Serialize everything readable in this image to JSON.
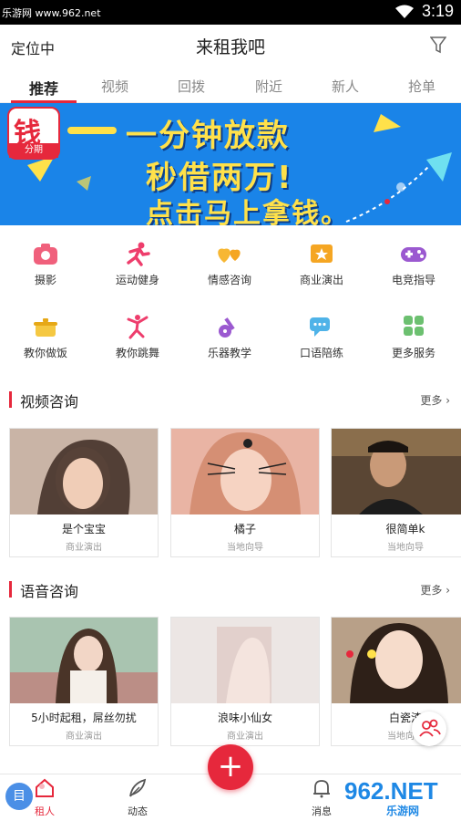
{
  "status_bar": {
    "watermark": "乐游网 www.962.net",
    "time": "3:19"
  },
  "header": {
    "location": "定位中",
    "title": "来租我吧"
  },
  "tabs": [
    {
      "label": "推荐",
      "active": true
    },
    {
      "label": "视频"
    },
    {
      "label": "回拨"
    },
    {
      "label": "附近"
    },
    {
      "label": "新人"
    },
    {
      "label": "抢单"
    }
  ],
  "banner": {
    "app_char": "钱",
    "app_sub": "分期",
    "line1": "一分钟放款",
    "line2": "秒借两万!",
    "line3": "点击马上拿钱。"
  },
  "categories": [
    {
      "label": "摄影",
      "icon": "camera-icon",
      "color": "#f0607c"
    },
    {
      "label": "运动健身",
      "icon": "running-icon",
      "color": "#ee3d6c"
    },
    {
      "label": "情感咨询",
      "icon": "hearts-icon",
      "color": "#f7b733"
    },
    {
      "label": "商业演出",
      "icon": "ticket-icon",
      "color": "#f5a623"
    },
    {
      "label": "电竞指导",
      "icon": "gamepad-icon",
      "color": "#9b59d0"
    },
    {
      "label": "教你做饭",
      "icon": "pot-icon",
      "color": "#f5c842"
    },
    {
      "label": "教你跳舞",
      "icon": "dancer-icon",
      "color": "#ee3d6c"
    },
    {
      "label": "乐器教学",
      "icon": "guitar-icon",
      "color": "#9b59d0"
    },
    {
      "label": "口语陪练",
      "icon": "chat-icon",
      "color": "#4fb3e8"
    },
    {
      "label": "更多服务",
      "icon": "grid-icon",
      "color": "#6cc070"
    }
  ],
  "video_section": {
    "title": "视频咨询",
    "more": "更多",
    "cards": [
      {
        "name": "是个宝宝",
        "tag": "商业演出"
      },
      {
        "name": "橘子",
        "tag": "当地向导"
      },
      {
        "name": "很简单k",
        "tag": "当地向导"
      }
    ]
  },
  "voice_section": {
    "title": "语音咨询",
    "more": "更多",
    "cards": [
      {
        "name": "5小时起租，屌丝勿扰",
        "tag": "商业演出"
      },
      {
        "name": "浪味小仙女",
        "tag": "商业演出"
      },
      {
        "name": "白瓷渣",
        "tag": "当地向导"
      }
    ]
  },
  "bottom_nav": {
    "rent_label": "租人",
    "feed_label": "动态",
    "plus_label": "+",
    "msg_label": "消息",
    "side_tag": "目"
  },
  "watermark_962": {
    "big": "962.NET",
    "small": "乐游网"
  },
  "colors": {
    "accent": "#e6283c",
    "banner_bg": "#1a84e8",
    "banner_text": "#ffe14a"
  }
}
